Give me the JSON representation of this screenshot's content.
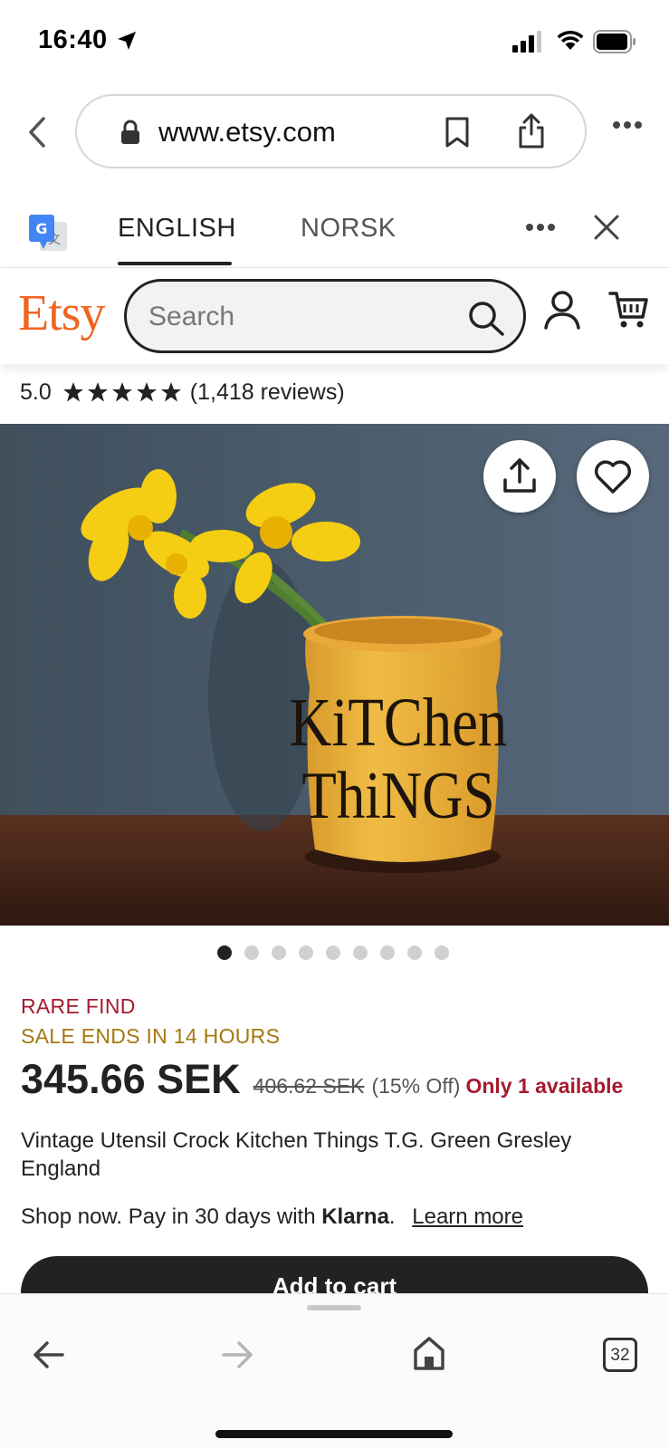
{
  "status_bar": {
    "time": "16:40"
  },
  "browser": {
    "url": "www.etsy.com",
    "tab_count": "32"
  },
  "translate_bar": {
    "languages": [
      "ENGLISH",
      "NORSK"
    ],
    "selected_language": "ENGLISH"
  },
  "header": {
    "logo": "Etsy",
    "search_placeholder": "Search"
  },
  "rating": {
    "value": "5.0",
    "stars": 5,
    "reviews": "(1,418 reviews)"
  },
  "hero": {
    "jar_text_line1": "KiTChen",
    "jar_text_line2": "ThiNGS",
    "image_count": 9,
    "active_image": 1
  },
  "listing": {
    "badge": "RARE FIND",
    "sale_notice": "SALE ENDS IN 14 HOURS",
    "price": "345.66 SEK",
    "original_price": "406.62 SEK",
    "discount": "(15% Off)",
    "availability": "Only 1 available",
    "title": "Vintage Utensil Crock Kitchen Things T.G. Green Gresley England",
    "klarna_prefix": "Shop now. Pay in 30 days with",
    "klarna_brand": "Klarna",
    "klarna_suffix": ".",
    "learn_more": "Learn more",
    "add_to_cart": "Add to cart"
  },
  "colors": {
    "etsy_orange": "#f1641e",
    "rare_find": "#a61a2e",
    "sale_notice": "#a57811"
  }
}
